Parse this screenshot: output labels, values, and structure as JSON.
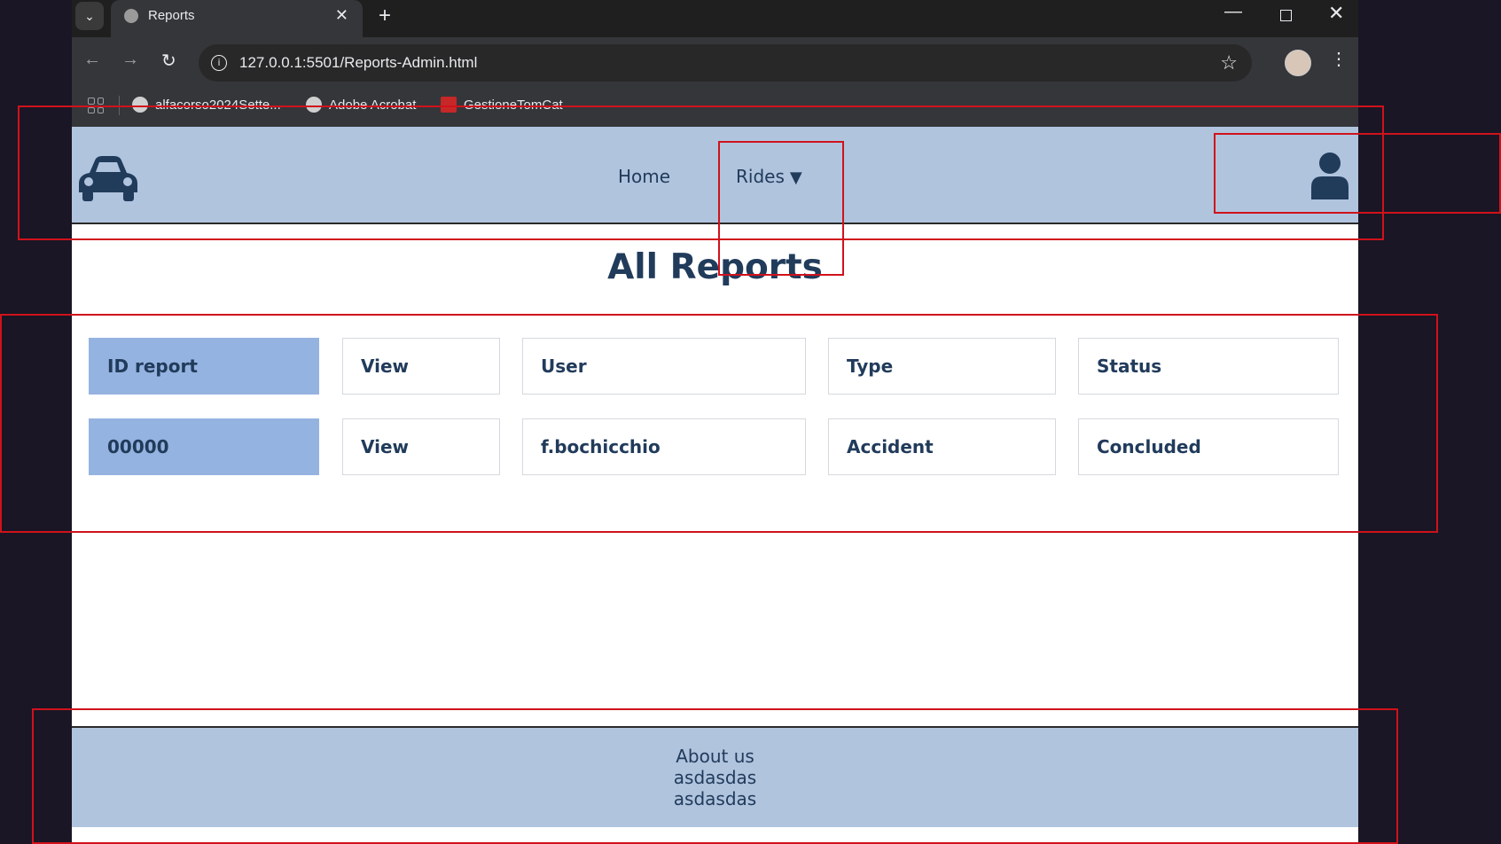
{
  "browser": {
    "tab_title": "Reports",
    "url": "127.0.0.1:5501/Reports-Admin.html",
    "bookmarks": [
      "alfacorso2024Sette...",
      "Adobe Acrobat",
      "GestioneTomCat"
    ]
  },
  "header": {
    "nav": {
      "home": "Home",
      "rides": "Rides"
    },
    "rides_caret": "▼"
  },
  "page": {
    "title": "All Reports"
  },
  "table": {
    "header": {
      "id": "ID report",
      "view": "View",
      "user": "User",
      "type": "Type",
      "status": "Status"
    },
    "rows": [
      {
        "id": "00000",
        "view": "View",
        "user": "f.bochicchio",
        "type": "Accident",
        "status": "Concluded"
      }
    ]
  },
  "footer": {
    "lines": [
      "About us",
      "asdasdas",
      "asdasdas"
    ]
  },
  "colors": {
    "header_bg": "#b0c4de",
    "id_cell_bg": "#95b3e0",
    "text": "#213b5b",
    "annotation": "#d0121b"
  }
}
